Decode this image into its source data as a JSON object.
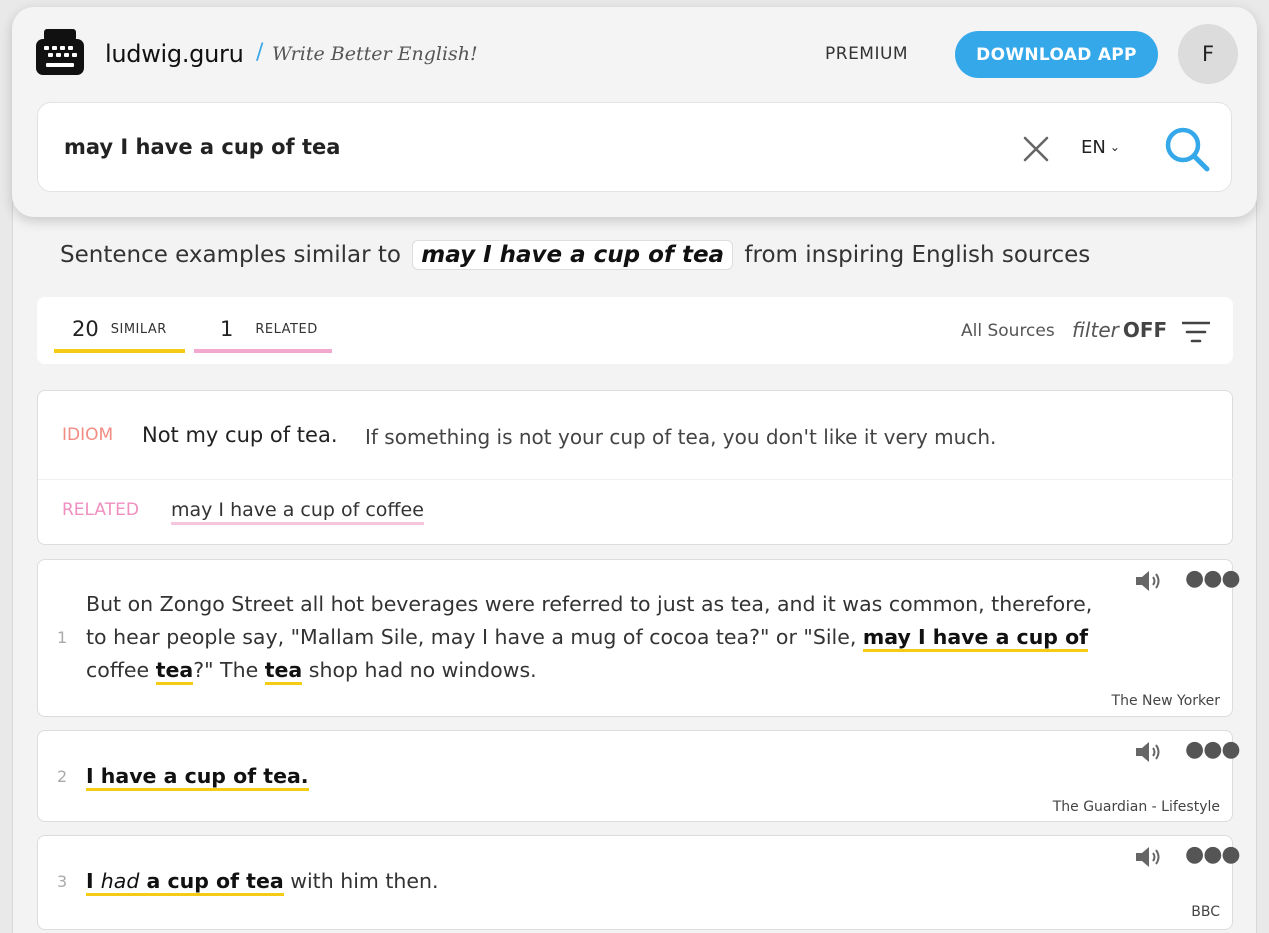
{
  "header": {
    "brand": "ludwig.guru",
    "separator": "/",
    "tagline": "Write Better English!",
    "premium_label": "PREMIUM",
    "download_label": "DOWNLOAD APP",
    "avatar_initial": "F"
  },
  "search": {
    "query": "may I have a cup of tea",
    "language": "EN"
  },
  "subtitle": {
    "prefix": "Sentence examples similar to",
    "term": "may I have a cup of tea",
    "suffix": "from inspiring English sources"
  },
  "tabs": {
    "similar": {
      "count": "20",
      "label": "SIMILAR"
    },
    "related": {
      "count": "1",
      "label": "RELATED"
    },
    "sources_label": "All Sources",
    "filter_word": "filter",
    "filter_state": "OFF"
  },
  "idiom": {
    "tag": "IDIOM",
    "phrase": "Not my cup of tea.",
    "definition": "If something is not your cup of tea, you don't like it very much.",
    "related_tag": "RELATED",
    "related_phrase": "may I have a cup of coffee"
  },
  "examples": [
    {
      "number": "1",
      "line1": "But on Zongo Street all hot beverages were referred to just as tea, and it was common, therefore,",
      "line2_pre": "to hear people say, \"Mallam Sile, may I have a mug of cocoa tea?\" or \"Sile, ",
      "line2_hl": "may I have a cup of",
      "line3_pre": "coffee ",
      "line3_hl1": "tea",
      "line3_mid": "?\" The ",
      "line3_hl2": "tea",
      "line3_post": " shop had no windows.",
      "source": "The New Yorker"
    },
    {
      "number": "2",
      "hl": "I have a cup of tea.",
      "source": "The Guardian - Lifestyle"
    },
    {
      "number": "3",
      "hl_a": "I ",
      "hl_b": "had",
      "hl_c": " a cup of tea",
      "rest": " with him then.",
      "source": "BBC"
    }
  ],
  "colors": {
    "accent_blue": "#35a8ea",
    "similar_underline": "#f4cc14",
    "related_underline": "#f2a8cf",
    "idiom_tag": "#f28b82"
  }
}
